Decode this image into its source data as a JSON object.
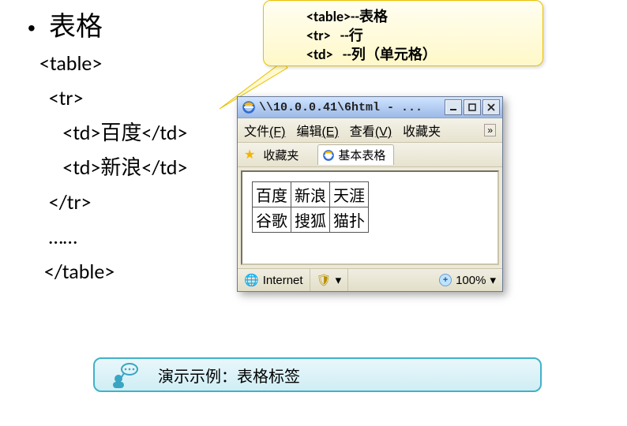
{
  "heading": "表格",
  "code_lines": "<table>\n  <tr>\n     <td>百度</td>\n     <td>新浪</td>\n  </tr>\n  ……\n </table>",
  "callout": {
    "line1": "<table>--表格",
    "line2": "<tr>   --行",
    "line3": "<td>   --列（单元格）"
  },
  "ie_window": {
    "title": "\\\\10.0.0.41\\6html - ...",
    "menus": {
      "file": "文件",
      "file_accel": "(F)",
      "edit": "编辑",
      "edit_accel": "(E)",
      "view": "查看",
      "view_accel": "(V)",
      "fav": "收藏夹",
      "overflow": "»"
    },
    "favbar_label": "收藏夹",
    "tab_label": "基本表格",
    "table": {
      "rows": [
        [
          "百度",
          "新浪",
          "天涯"
        ],
        [
          "谷歌",
          "搜狐",
          "猫扑"
        ]
      ]
    },
    "status": {
      "zone": "Internet",
      "zoom": "100%"
    }
  },
  "demo_banner": "演示示例：表格标签"
}
